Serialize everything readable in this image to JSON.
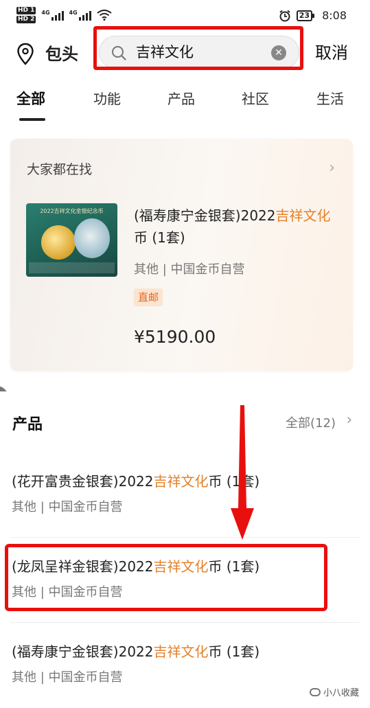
{
  "status_bar": {
    "hd1": "HD 1",
    "hd2": "HD 2",
    "net1": "4G",
    "net2": "4G",
    "battery": "23",
    "time": "8:08"
  },
  "search": {
    "city": "包头",
    "query": "吉祥文化",
    "cancel_label": "取消"
  },
  "tabs": [
    "全部",
    "功能",
    "产品",
    "社区",
    "生活"
  ],
  "recommend": {
    "heading": "大家都在找",
    "thumb_caption": "2022吉祥文化金银纪念币",
    "title_prefix": "(福寿康宁金银套)2022",
    "title_highlight": "吉祥文化",
    "title_suffix": "币 (1套)",
    "meta": "其他 | 中国金币自营",
    "tag": "直邮",
    "price": "¥5190.00"
  },
  "products": {
    "heading": "产品",
    "all_label": "全部(12)",
    "items": [
      {
        "prefix": "(花开富贵金银套)2022",
        "highlight": "吉祥文化",
        "suffix": "币 (1套)",
        "meta": "其他 | 中国金币自营"
      },
      {
        "prefix": "(龙凤呈祥金银套)2022",
        "highlight": "吉祥文化",
        "suffix": "币 (1套)",
        "meta": "其他 | 中国金币自营"
      },
      {
        "prefix": "(福寿康宁金银套)2022",
        "highlight": "吉祥文化",
        "suffix": "币 (1套)",
        "meta": "其他 | 中国金币自营"
      }
    ]
  },
  "watermark": "小八收藏",
  "colors": {
    "highlight": "#e4812a",
    "annotation_red": "#e8100e"
  }
}
